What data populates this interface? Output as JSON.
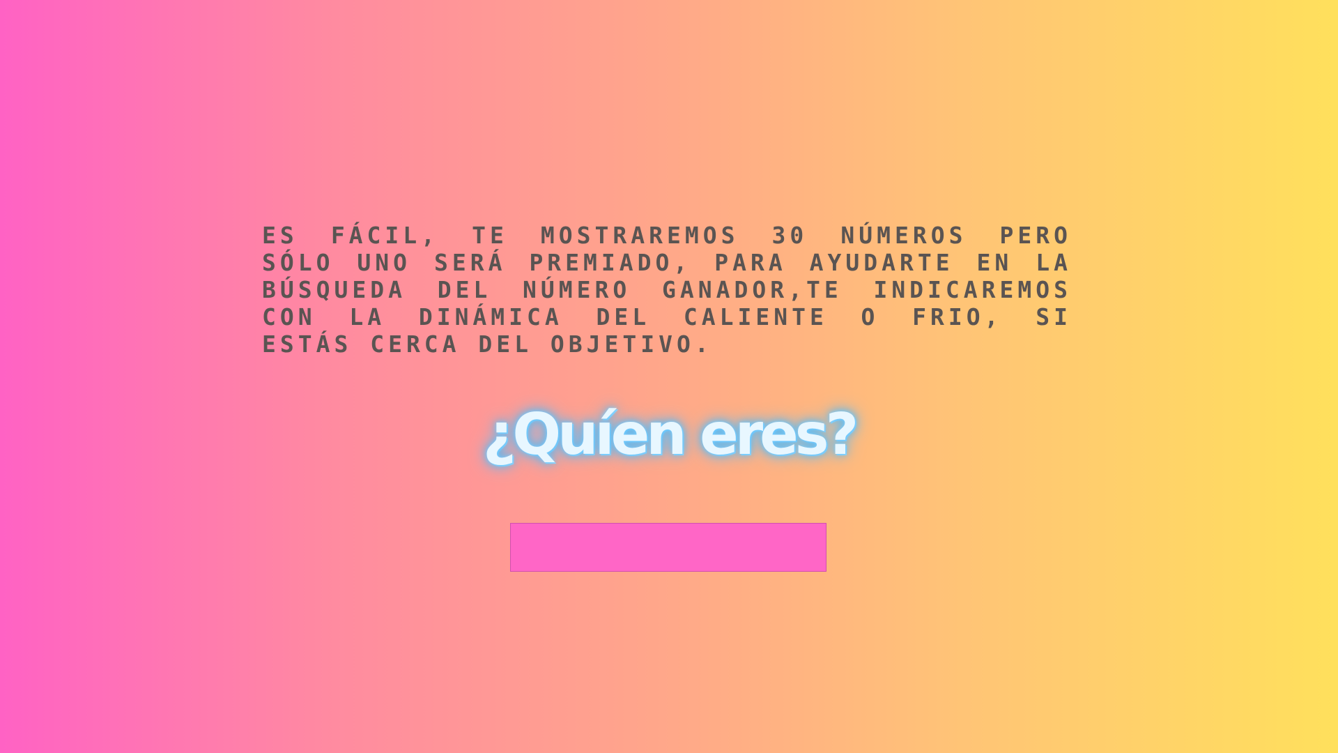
{
  "intro": {
    "text": "Es fácil, te mostraremos 30 números pero sólo uno será premiado, para ayudarte en la búsqueda del número ganador,te indicaremos con la dinámica del caliente o frio, si estás cerca del objetivo."
  },
  "prompt": {
    "title": "¿Quíen eres?"
  },
  "name_input": {
    "value": "",
    "placeholder": ""
  },
  "colors": {
    "gradient_left": "#ff62c4",
    "gradient_right": "#ffe05c",
    "input_background": "#ff66c6",
    "title_glow": "#63c4ff",
    "text": "#5a5452"
  }
}
